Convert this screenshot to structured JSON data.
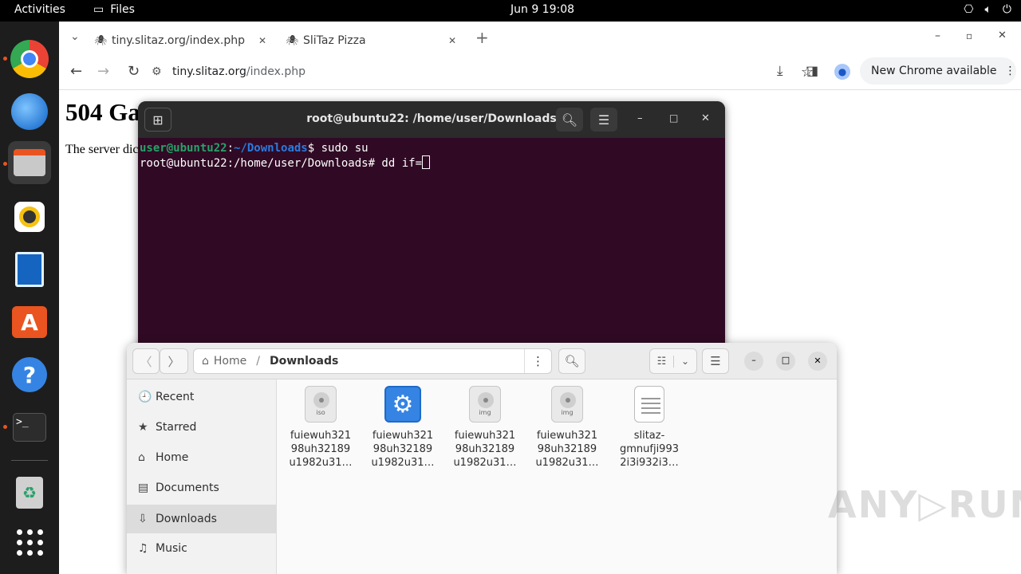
{
  "topbar": {
    "activities": "Activities",
    "app_name": "Files",
    "clock": "Jun 9  19:08"
  },
  "browser": {
    "tabs": [
      {
        "title": "tiny.slitaz.org/index.php",
        "close": "✕"
      },
      {
        "title": "SliTaz Pizza",
        "close": "✕"
      }
    ],
    "new_tab": "+",
    "tab_list": "⌄",
    "url_domain": "tiny.slitaz.org",
    "url_path": "/index.php",
    "update_label": "New Chrome available",
    "page_heading": "504 Ga",
    "page_text": "The server dic"
  },
  "terminal": {
    "title": "root@ubuntu22: /home/user/Downloads",
    "line1_user": "user@ubuntu22",
    "line1_sep": ":",
    "line1_path": "~/Downloads",
    "line1_cmd": "$ sudo su",
    "line2": "root@ubuntu22:/home/user/Downloads# dd if="
  },
  "files": {
    "path_home": "Home",
    "path_sep": "/",
    "path_current": "Downloads",
    "sidebar": [
      {
        "label": "Recent",
        "icon": "clock-icon",
        "glyph": "🕘"
      },
      {
        "label": "Starred",
        "icon": "star-icon",
        "glyph": "★"
      },
      {
        "label": "Home",
        "icon": "home-icon",
        "glyph": "⌂"
      },
      {
        "label": "Documents",
        "icon": "documents-icon",
        "glyph": "▤"
      },
      {
        "label": "Downloads",
        "icon": "download-icon",
        "glyph": "⇩"
      },
      {
        "label": "Music",
        "icon": "music-icon",
        "glyph": "♫"
      }
    ],
    "items": [
      {
        "l1": "fuiewuh321",
        "l2": "98uh32189",
        "l3": "u1982u31…",
        "type": "iso"
      },
      {
        "l1": "fuiewuh321",
        "l2": "98uh32189",
        "l3": "u1982u31…",
        "type": "exec"
      },
      {
        "l1": "fuiewuh321",
        "l2": "98uh32189",
        "l3": "u1982u31…",
        "type": "img"
      },
      {
        "l1": "fuiewuh321",
        "l2": "98uh32189",
        "l3": "u1982u31…",
        "type": "img"
      },
      {
        "l1": "slitaz-",
        "l2": "gmnufji993",
        "l3": "2i3i932i3…",
        "type": "text"
      }
    ]
  },
  "watermark": "ANY▷RUN"
}
